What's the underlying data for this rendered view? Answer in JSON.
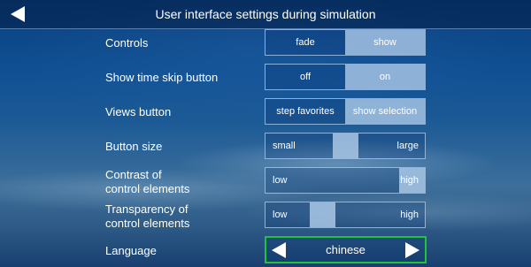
{
  "header": {
    "title": "User interface settings during simulation",
    "back_icon": "arrow-left-icon"
  },
  "settings": {
    "controls": {
      "label": "Controls",
      "options": [
        "fade",
        "show"
      ],
      "selected": "show"
    },
    "time_skip": {
      "label": "Show time skip button",
      "options": [
        "off",
        "on"
      ],
      "selected": "on"
    },
    "views_button": {
      "label": "Views button",
      "options": [
        "step favorites",
        "show selection"
      ],
      "selected": "show selection"
    },
    "button_size": {
      "label": "Button size",
      "min_label": "small",
      "max_label": "large",
      "value": 0.5
    },
    "contrast": {
      "label_line1": "Contrast of",
      "label_line2": "control elements",
      "min_label": "low",
      "max_label": "high",
      "value": 1.0
    },
    "transparency": {
      "label_line1": "Transparency of",
      "label_line2": "control elements",
      "min_label": "low",
      "max_label": "high",
      "value": 0.33
    },
    "language": {
      "label": "Language",
      "value": "chinese",
      "prev_icon": "arrow-left-icon",
      "next_icon": "arrow-right-icon"
    }
  },
  "colors": {
    "active_segment": "#a5c3e4",
    "focus_border": "#23c23a",
    "header_bg": "#0a2e5c"
  }
}
